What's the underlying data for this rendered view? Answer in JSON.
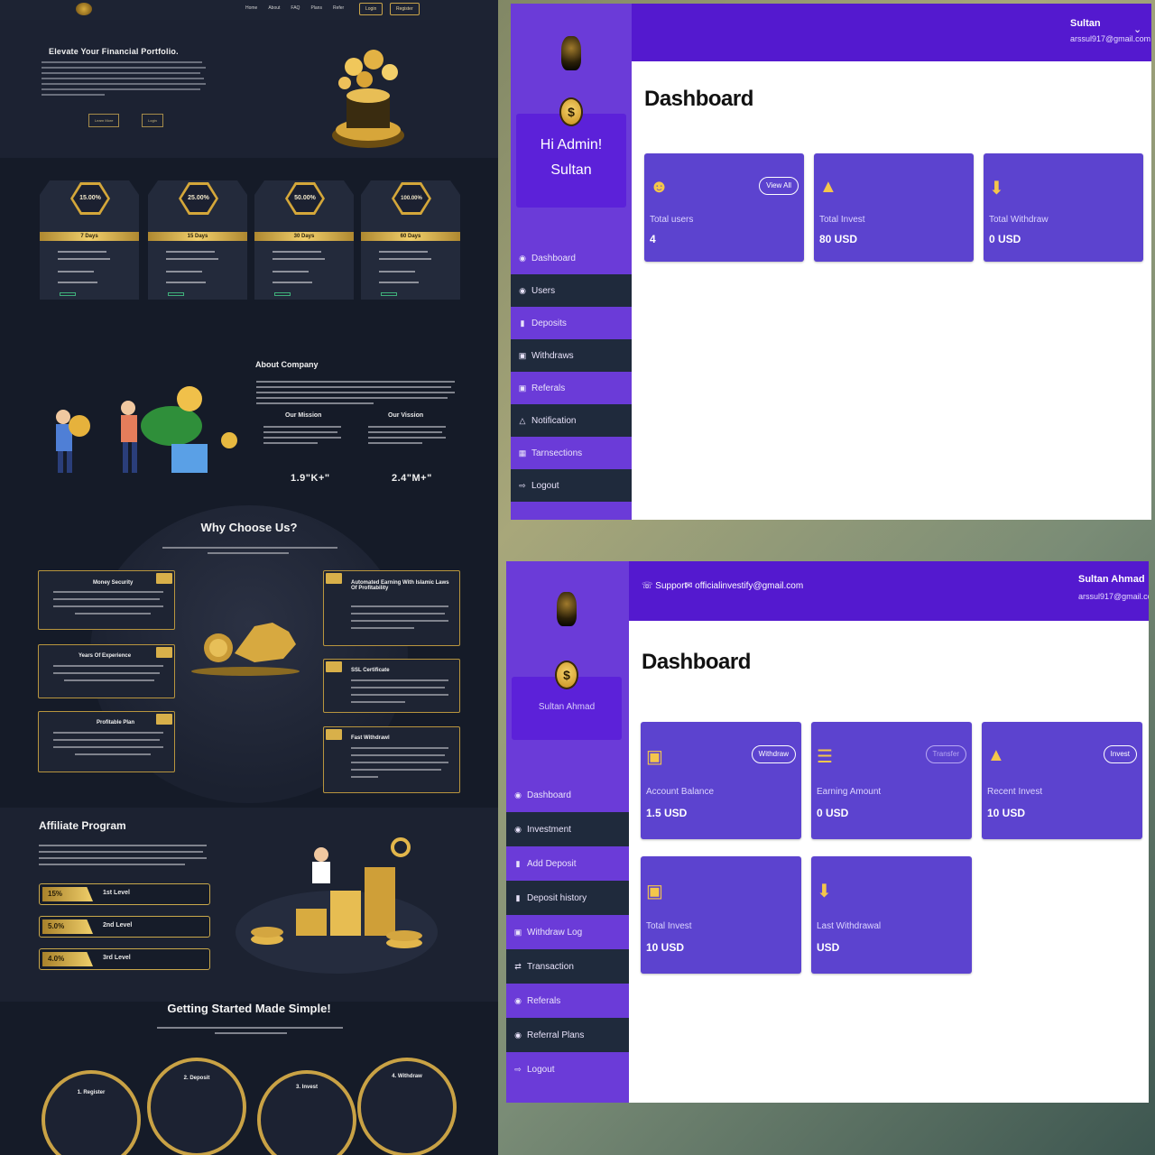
{
  "landing": {
    "nav": {
      "links": [
        "Home",
        "About",
        "FAQ",
        "Plans",
        "Refer"
      ],
      "login": "Login",
      "register": "Register"
    },
    "hero": {
      "title": "Elevate Your Financial Portfolio.",
      "btn_primary": "Learn More",
      "btn_secondary": "Login"
    },
    "plans": [
      {
        "rate": "15.00%",
        "duration": "7 Days"
      },
      {
        "rate": "25.00%",
        "duration": "15 Days"
      },
      {
        "rate": "50.00%",
        "duration": "30 Days"
      },
      {
        "rate": "100.00%",
        "duration": "60 Days"
      }
    ],
    "about": {
      "title": "About Company",
      "mission": "Our Mission",
      "vision": "Our Vission",
      "stat1": "1.9\"K+\"",
      "stat2": "2.4\"M+\""
    },
    "why": {
      "title": "Why Choose Us?",
      "features": [
        "Money Security",
        "Automated Earning With Islamic Laws Of Profitability",
        "Years Of Experience",
        "SSL Certificate",
        "Profitable Plan",
        "Fast Withdrawl"
      ]
    },
    "affiliate": {
      "title": "Affiliate Program",
      "levels": [
        {
          "pct": "15%",
          "name": "1st Level"
        },
        {
          "pct": "5.0%",
          "name": "2nd Level"
        },
        {
          "pct": "4.0%",
          "name": "3rd Level"
        }
      ]
    },
    "started": {
      "title": "Getting Started Made Simple!",
      "steps": [
        "1. Register",
        "2. Deposit",
        "3. Invest",
        "4. Withdraw"
      ]
    }
  },
  "admin": {
    "header": {
      "name": "Sultan",
      "email": "arssul917@gmail.com"
    },
    "greeting": "Hi Admin!",
    "greeting_name": "Sultan",
    "title": "Dashboard",
    "menu": [
      "Dashboard",
      "Users",
      "Deposits",
      "Withdraws",
      "Referals",
      "Notification",
      "Tarnsections",
      "Logout"
    ],
    "cards": [
      {
        "label": "Total users",
        "value": "4",
        "button": "View All"
      },
      {
        "label": "Total Invest",
        "value": "80 USD"
      },
      {
        "label": "Total Withdraw",
        "value": "0 USD"
      }
    ]
  },
  "user": {
    "header": {
      "support": "Support",
      "email_link": "officialinvestify@gmail.com",
      "name": "Sultan Ahmad",
      "email": "arssul917@gmail.com"
    },
    "side_name": "Sultan Ahmad",
    "title": "Dashboard",
    "menu": [
      "Dashboard",
      "Investment",
      "Add Deposit",
      "Deposit history",
      "Withdraw Log",
      "Transaction",
      "Referals",
      "Referral Plans",
      "Logout"
    ],
    "cards": [
      {
        "label": "Account Balance",
        "value": "1.5 USD",
        "button": "Withdraw"
      },
      {
        "label": "Earning Amount",
        "value": "0 USD",
        "button": "Transfer"
      },
      {
        "label": "Recent Invest",
        "value": "10 USD",
        "button": "Invest"
      },
      {
        "label": "Total Invest",
        "value": "10 USD"
      },
      {
        "label": "Last Withdrawal",
        "value": "USD"
      }
    ]
  }
}
